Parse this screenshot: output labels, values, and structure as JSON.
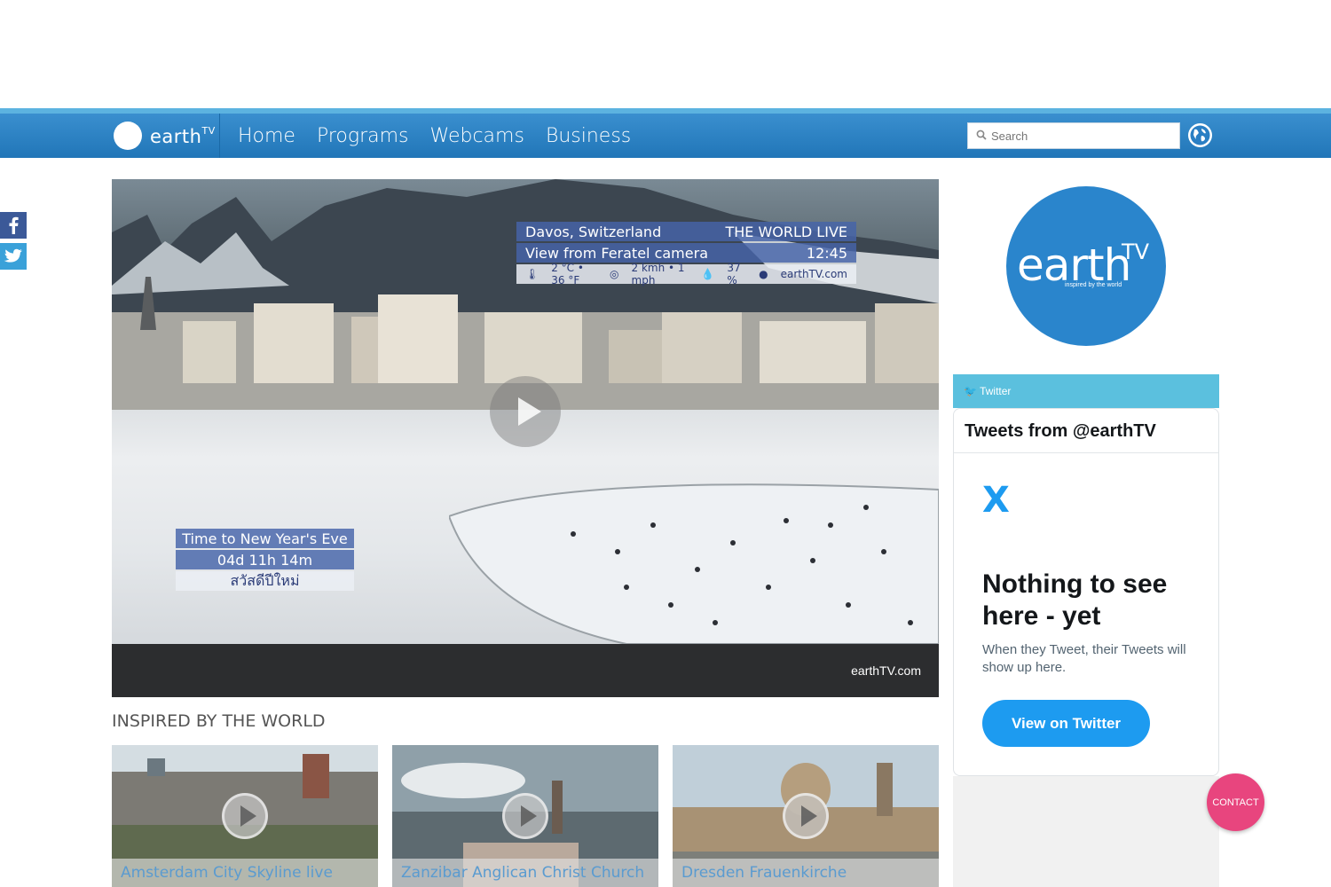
{
  "nav": {
    "brand": "earth",
    "brand_sup": "TV",
    "links": [
      "Home",
      "Programs",
      "Webcams",
      "Business"
    ],
    "search_placeholder": "Search"
  },
  "player": {
    "overlay": {
      "location": "Davos, Switzerland",
      "channel": "THE WORLD LIVE",
      "camera": "View from Feratel camera",
      "time": "12:45",
      "temperature": "2 °C • 36 °F",
      "wind": "2 kmh • 1 mph",
      "humidity": "37 %",
      "site": "earthTV.com"
    },
    "countdown": {
      "label": "Time to New Year's Eve",
      "value": "04d 11h 14m",
      "greeting": "สวัสดีปีใหม่"
    },
    "brand": "earthTV.com"
  },
  "section": {
    "title": "INSPIRED BY THE WORLD",
    "thumbs": [
      {
        "caption": "Amsterdam City Skyline live"
      },
      {
        "caption": "Zanzibar Anglican Christ Church"
      },
      {
        "caption": "Dresden Frauenkirche"
      }
    ]
  },
  "sidebar": {
    "logo_main": "earth",
    "logo_tv": "TV",
    "logo_tagline": "inspired by the world",
    "twitter_label": "Twitter",
    "twitter_card": {
      "header": "Tweets from @earthTV",
      "empty_title": "Nothing to see here - yet",
      "empty_sub": "When they Tweet, their Tweets will show up here.",
      "button": "View on Twitter"
    }
  },
  "contact": "CONTACT",
  "colors": {
    "nav": "#2176b8",
    "accent_pink": "#e8457e",
    "twitter_blue": "#1d9bf0"
  }
}
